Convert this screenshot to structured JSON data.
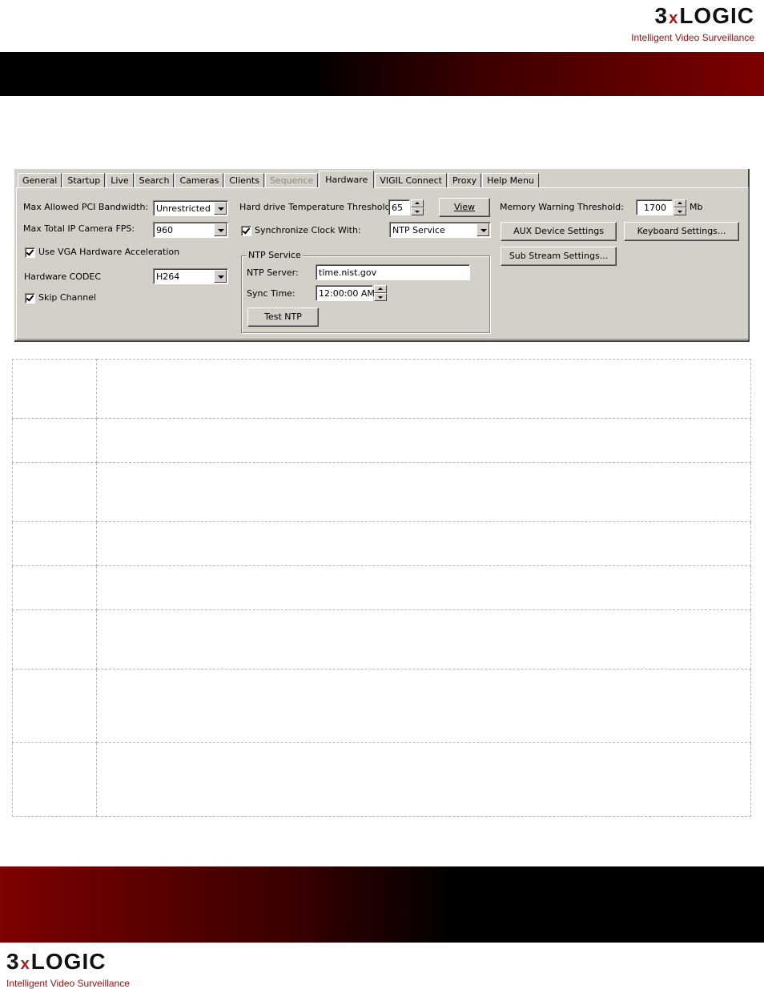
{
  "brand": {
    "logo_prefix": "3",
    "logo_x": "x",
    "logo_suffix": "LOGIC",
    "tagline": "Intelligent Video Surveillance",
    "accent_color": "#b01418",
    "band_color": "#7e0000"
  },
  "dialog": {
    "tabs": [
      {
        "label": "General",
        "state": "normal"
      },
      {
        "label": "Startup",
        "state": "normal"
      },
      {
        "label": "Live",
        "state": "normal"
      },
      {
        "label": "Search",
        "state": "normal"
      },
      {
        "label": "Cameras",
        "state": "normal"
      },
      {
        "label": "Clients",
        "state": "normal"
      },
      {
        "label": "Sequence",
        "state": "disabled"
      },
      {
        "label": "Hardware",
        "state": "active"
      },
      {
        "label": "VIGIL Connect",
        "state": "normal"
      },
      {
        "label": "Proxy",
        "state": "normal"
      },
      {
        "label": "Help Menu",
        "state": "normal"
      }
    ],
    "left": {
      "pci_label": "Max Allowed PCI Bandwidth:",
      "pci_value": "Unrestricted",
      "fps_label": "Max Total IP Camera FPS:",
      "fps_value": "960",
      "vga_label": "Use VGA Hardware Acceleration",
      "vga_checked": true,
      "codec_label": "Hardware CODEC",
      "codec_value": "H264",
      "skip_label": "Skip Channel",
      "skip_checked": true
    },
    "middle": {
      "temp_label": "Hard drive Temperature Threshold:",
      "temp_value": "65",
      "view_button": "View",
      "sync_label": "Synchronize Clock With:",
      "sync_checked": true,
      "sync_value": "NTP Service",
      "ntp_group_label": "NTP Service",
      "ntp_server_label": "NTP Server:",
      "ntp_server_value": "time.nist.gov",
      "sync_time_label": "Sync Time:",
      "sync_time_value": "12:00:00 AM",
      "test_ntp_button": "Test NTP"
    },
    "right": {
      "memory_label": "Memory Warning Threshold:",
      "memory_value": "1700",
      "memory_unit": "Mb",
      "aux_button": "AUX Device Settings",
      "keyboard_button": "Keyboard Settings...",
      "substream_button": "Sub Stream Settings..."
    }
  },
  "table": {
    "rows": [
      {
        "setting": "",
        "description": ""
      },
      {
        "setting": "",
        "description": ""
      },
      {
        "setting": "",
        "description": ""
      },
      {
        "setting": "",
        "description": ""
      },
      {
        "setting": "",
        "description": ""
      },
      {
        "setting": "",
        "description": ""
      },
      {
        "setting": "",
        "description": ""
      },
      {
        "setting": "",
        "description": ""
      }
    ]
  }
}
